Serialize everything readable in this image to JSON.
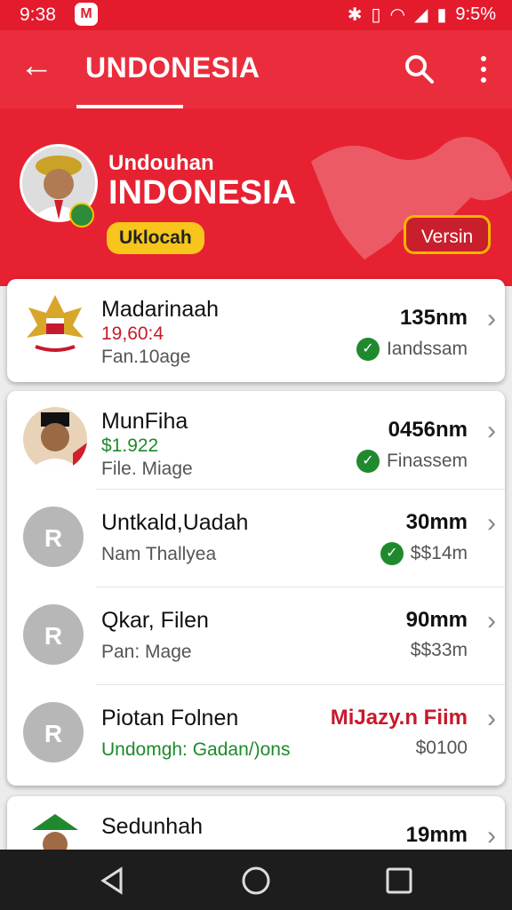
{
  "status_bar": {
    "time": "9:38",
    "notification_badge": "M",
    "battery": "9:5%"
  },
  "app_bar": {
    "title": "UNDONESIA"
  },
  "hero": {
    "subtitle": "Undouhan",
    "title": "INDONESIA",
    "chip_label": "Uklocah",
    "version_button": "Versin"
  },
  "items": [
    {
      "name": "Madarinaah",
      "line1": "19,60:4",
      "line2": "Fan.10age",
      "value": "135nm",
      "status": "Iandssam",
      "verified": true
    },
    {
      "name": "MunFiha",
      "line1": "$1.922",
      "line2": "File. Miage",
      "value": "0456nm",
      "status": "Finassem",
      "verified": true
    },
    {
      "name": "Untkald,Uadah",
      "line1": "",
      "line2": "Nam Thallyea",
      "value": "30mm",
      "status": "$$14m",
      "verified": true
    },
    {
      "name": "Qkar, Filen",
      "line1": "",
      "line2": "Pan: Mage",
      "value": "90mm",
      "status": "$$33m",
      "verified": false
    },
    {
      "name": "Piotan Folnen",
      "line1": "",
      "line2": "Undomgh: Gadan/)ons",
      "value": "MiJazy.n Fiim",
      "status": "$0100",
      "verified": false
    },
    {
      "name": "Sedunhah",
      "line1": "",
      "line2": "",
      "value": "19mm",
      "status": "",
      "verified": false
    }
  ],
  "placeholder_initial": "R",
  "colors": {
    "brand_red": "#e62232",
    "accent_yellow": "#f7c51b",
    "check_green": "#1f8a2d"
  }
}
